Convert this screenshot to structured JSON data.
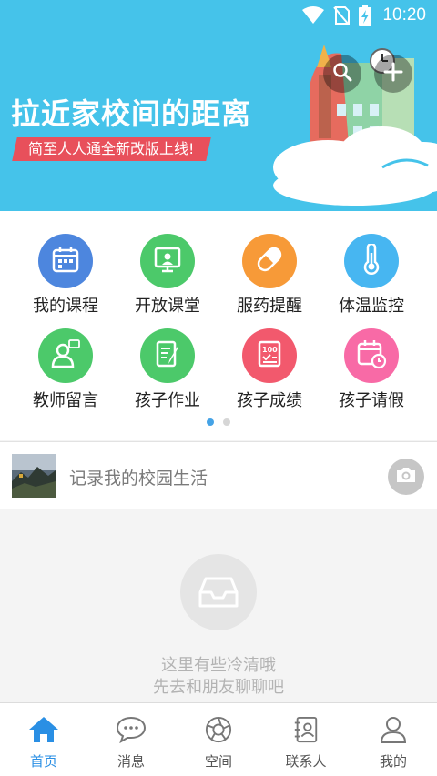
{
  "status_bar": {
    "time": "10:20"
  },
  "banner": {
    "headline": "拉近家校间的距离",
    "tagline": "简至人人通全新改版上线!"
  },
  "colors": {
    "primary_blue": "#45c3ea",
    "ribbon_red": "#e8505b",
    "active_nav": "#2a8fe4",
    "dot_active": "#45a3e6",
    "dot_inactive": "#d6d6d6"
  },
  "features": [
    {
      "label": "我的课程",
      "icon": "calendar-icon",
      "color": "#4d86de"
    },
    {
      "label": "开放课堂",
      "icon": "classroom-screen-icon",
      "color": "#4cc96a"
    },
    {
      "label": "服药提醒",
      "icon": "pill-icon",
      "color": "#f79a38"
    },
    {
      "label": "体温监控",
      "icon": "thermometer-icon",
      "color": "#47b6f1"
    },
    {
      "label": "教师留言",
      "icon": "teacher-message-icon",
      "color": "#4cc96a"
    },
    {
      "label": "孩子作业",
      "icon": "homework-icon",
      "color": "#4cc96a"
    },
    {
      "label": "孩子成绩",
      "icon": "score-sheet-icon",
      "color": "#f2596d"
    },
    {
      "label": "孩子请假",
      "icon": "leave-calendar-icon",
      "color": "#f86aa6"
    }
  ],
  "page_indicator": {
    "pages": 2,
    "current": 1
  },
  "record": {
    "label": "记录我的校园生活"
  },
  "empty_state": {
    "line1": "这里有些冷清哦",
    "line2": "先去和朋友聊聊吧"
  },
  "bottom_nav": [
    {
      "label": "首页",
      "icon": "home-icon",
      "active": true
    },
    {
      "label": "消息",
      "icon": "chat-bubble-icon",
      "active": false
    },
    {
      "label": "空间",
      "icon": "aperture-icon",
      "active": false
    },
    {
      "label": "联系人",
      "icon": "contacts-book-icon",
      "active": false
    },
    {
      "label": "我的",
      "icon": "person-icon",
      "active": false
    }
  ]
}
